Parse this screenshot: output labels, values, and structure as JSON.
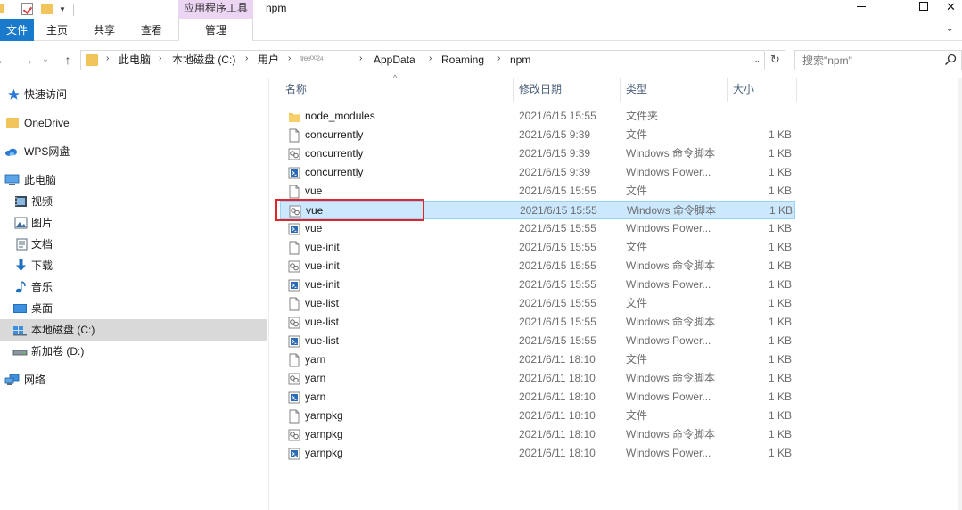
{
  "window": {
    "title": "npm",
    "context_tab_group": "应用程序工具",
    "minimize_glyph": "—",
    "maximize_glyph": "☐",
    "close_glyph": "✕"
  },
  "ribbon": {
    "tabs": [
      "文件",
      "主页",
      "共享",
      "查看",
      "管理"
    ],
    "collapse_glyph": "⌄"
  },
  "nav": {
    "back_glyph": "←",
    "forward_glyph": "→",
    "recent_glyph": "⌄",
    "up_glyph": "↑",
    "refresh_glyph": "↻",
    "dropdown_glyph": "⌄"
  },
  "address": {
    "crumbs": [
      "此电脑",
      "本地磁盘 (C:)",
      "用户",
      "ᵗʳᵉᵉ⁰⁰²⁴",
      "AppData",
      "Roaming",
      "npm"
    ],
    "separator": "›"
  },
  "search": {
    "placeholder": "搜索\"npm\""
  },
  "sidebar": {
    "items": [
      {
        "label": "快速访问",
        "icon": "star-icon"
      },
      {
        "label": "OneDrive",
        "icon": "onedrive-folder-icon"
      },
      {
        "label": "WPS网盘",
        "icon": "cloud-icon"
      },
      {
        "label": "此电脑",
        "icon": "computer-icon"
      },
      {
        "label": "视频",
        "icon": "video-icon"
      },
      {
        "label": "图片",
        "icon": "pictures-icon"
      },
      {
        "label": "文档",
        "icon": "documents-icon"
      },
      {
        "label": "下载",
        "icon": "download-icon"
      },
      {
        "label": "音乐",
        "icon": "music-icon"
      },
      {
        "label": "桌面",
        "icon": "desktop-icon"
      },
      {
        "label": "本地磁盘 (C:)",
        "icon": "drive-c-icon",
        "selected": true
      },
      {
        "label": "新加卷 (D:)",
        "icon": "drive-d-icon"
      },
      {
        "label": "网络",
        "icon": "network-icon"
      }
    ]
  },
  "columns": {
    "name": "名称",
    "date": "修改日期",
    "type": "类型",
    "size": "大小",
    "sort_glyph": "^"
  },
  "files": [
    {
      "name": "node_modules",
      "date": "2021/6/15 15:55",
      "type": "文件夹",
      "size": "",
      "icon": "folder-icon"
    },
    {
      "name": "concurrently",
      "date": "2021/6/15 9:39",
      "type": "文件",
      "size": "1 KB",
      "icon": "file-icon"
    },
    {
      "name": "concurrently",
      "date": "2021/6/15 9:39",
      "type": "Windows 命令脚本",
      "size": "1 KB",
      "icon": "cmd-script-icon"
    },
    {
      "name": "concurrently",
      "date": "2021/6/15 9:39",
      "type": "Windows Power...",
      "size": "1 KB",
      "icon": "powershell-script-icon"
    },
    {
      "name": "vue",
      "date": "2021/6/15 15:55",
      "type": "文件",
      "size": "1 KB",
      "icon": "file-icon"
    },
    {
      "name": "vue",
      "date": "2021/6/15 15:55",
      "type": "Windows 命令脚本",
      "size": "1 KB",
      "icon": "cmd-script-icon",
      "selected": true
    },
    {
      "name": "vue",
      "date": "2021/6/15 15:55",
      "type": "Windows Power...",
      "size": "1 KB",
      "icon": "powershell-script-icon"
    },
    {
      "name": "vue-init",
      "date": "2021/6/15 15:55",
      "type": "文件",
      "size": "1 KB",
      "icon": "file-icon"
    },
    {
      "name": "vue-init",
      "date": "2021/6/15 15:55",
      "type": "Windows 命令脚本",
      "size": "1 KB",
      "icon": "cmd-script-icon"
    },
    {
      "name": "vue-init",
      "date": "2021/6/15 15:55",
      "type": "Windows Power...",
      "size": "1 KB",
      "icon": "powershell-script-icon"
    },
    {
      "name": "vue-list",
      "date": "2021/6/15 15:55",
      "type": "文件",
      "size": "1 KB",
      "icon": "file-icon"
    },
    {
      "name": "vue-list",
      "date": "2021/6/15 15:55",
      "type": "Windows 命令脚本",
      "size": "1 KB",
      "icon": "cmd-script-icon"
    },
    {
      "name": "vue-list",
      "date": "2021/6/15 15:55",
      "type": "Windows Power...",
      "size": "1 KB",
      "icon": "powershell-script-icon"
    },
    {
      "name": "yarn",
      "date": "2021/6/11 18:10",
      "type": "文件",
      "size": "1 KB",
      "icon": "file-icon"
    },
    {
      "name": "yarn",
      "date": "2021/6/11 18:10",
      "type": "Windows 命令脚本",
      "size": "1 KB",
      "icon": "cmd-script-icon"
    },
    {
      "name": "yarn",
      "date": "2021/6/11 18:10",
      "type": "Windows Power...",
      "size": "1 KB",
      "icon": "powershell-script-icon"
    },
    {
      "name": "yarnpkg",
      "date": "2021/6/11 18:10",
      "type": "文件",
      "size": "1 KB",
      "icon": "file-icon"
    },
    {
      "name": "yarnpkg",
      "date": "2021/6/11 18:10",
      "type": "Windows 命令脚本",
      "size": "1 KB",
      "icon": "cmd-script-icon"
    },
    {
      "name": "yarnpkg",
      "date": "2021/6/11 18:10",
      "type": "Windows Power...",
      "size": "1 KB",
      "icon": "powershell-script-icon"
    }
  ],
  "colors": {
    "file_tab": "#1979ca",
    "context_tab": "#ecd5f3",
    "selection": "#cce8ff",
    "selection_border": "#99d1ff",
    "annotation_box": "#e3242b",
    "folder": "#f2c55c"
  }
}
